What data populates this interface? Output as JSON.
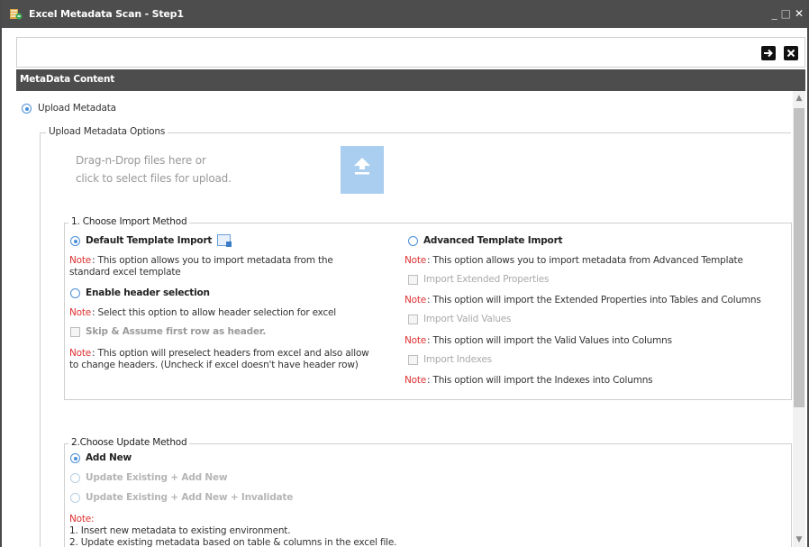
{
  "window": {
    "title": "Excel Metadata Scan - Step1",
    "controls": {
      "minimize": "_",
      "maximize": "□",
      "close": "✕"
    }
  },
  "toolbar": {
    "next_icon": "→",
    "close_icon": "✕"
  },
  "section": {
    "header": "MetaData Content"
  },
  "upload": {
    "option_label": "Upload Metadata",
    "options_legend": "Upload Metadata Options",
    "dnd_line1": "Drag-n-Drop files here or",
    "dnd_line2": "click to select files for upload."
  },
  "import_method": {
    "legend": "1. Choose Import Method",
    "default_label": "Default Template Import",
    "default_note_prefix": "Note",
    "default_note_line1": ": This option allows you to import metadata from the",
    "default_note_line2": "standard excel template",
    "header_label": "Enable header selection",
    "header_note_prefix": "Note",
    "header_note": ": Select this option to allow header selection for excel",
    "skip_label": "Skip & Assume first row as header.",
    "skip_note_prefix": "Note",
    "skip_note_line1": ": This option will preselect headers from excel and also allow",
    "skip_note_line2": "to change headers. (Uncheck if excel doesn't have header row)",
    "advanced_label": "Advanced Template Import",
    "advanced_note_prefix": "Note",
    "advanced_note": ": This option allows you to import metadata from Advanced Template",
    "ext_props_label": "Import Extended Properties",
    "ext_props_note_prefix": "Note",
    "ext_props_note": ": This option will import the Extended Properties into Tables and Columns",
    "valid_values_label": "Import Valid Values",
    "valid_values_note_prefix": "Note",
    "valid_values_note": ": This option will import the Valid Values into Columns",
    "indexes_label": "Import Indexes",
    "indexes_note_prefix": "Note",
    "indexes_note": ": This option will import the Indexes into Columns"
  },
  "update_method": {
    "legend": "2.Choose Update Method",
    "add_new_label": "Add New",
    "update_add_label": "Update Existing + Add New",
    "update_add_invalidate_label": "Update Existing + Add New + Invalidate",
    "note_prefix": "Note:",
    "note_line1": "1. Insert new metadata to existing environment.",
    "note_line2": "2. Update existing metadata based on table & columns in the excel file."
  },
  "colors": {
    "titlebar": "#4d4d4d",
    "accent": "#4a90d9",
    "note_red": "#e03030",
    "upload_box": "#a9cef0"
  },
  "icons": [
    "excel-scan-app-icon",
    "arrow-right-icon",
    "close-icon",
    "upload-icon",
    "template-icon"
  ]
}
